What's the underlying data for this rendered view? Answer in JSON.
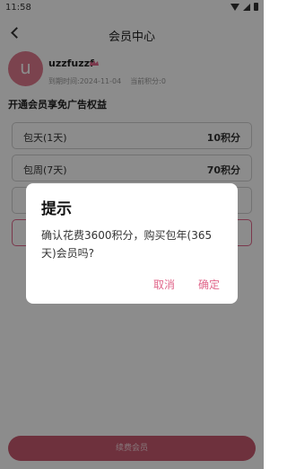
{
  "status_bar": {
    "time": "11:58"
  },
  "header": {
    "title": "会员中心"
  },
  "user": {
    "avatar_letter": "u",
    "name": "uzzfuzzf",
    "expire": "到期时间:2024-11-04",
    "points": "当前积分:0"
  },
  "section": {
    "title": "开通会员享免广告权益"
  },
  "plans": [
    {
      "name": "包天(1天)",
      "price": "10积分"
    },
    {
      "name": "包周(7天)",
      "price": "70积分"
    }
  ],
  "dialog": {
    "title": "提示",
    "message": "确认花费3600积分，购买包年(365天)会员吗?",
    "cancel": "取消",
    "confirm": "确定"
  },
  "footer": {
    "renew_label": "续费会员"
  },
  "colors": {
    "accent": "#e0668a",
    "avatar": "#e07b8f"
  }
}
